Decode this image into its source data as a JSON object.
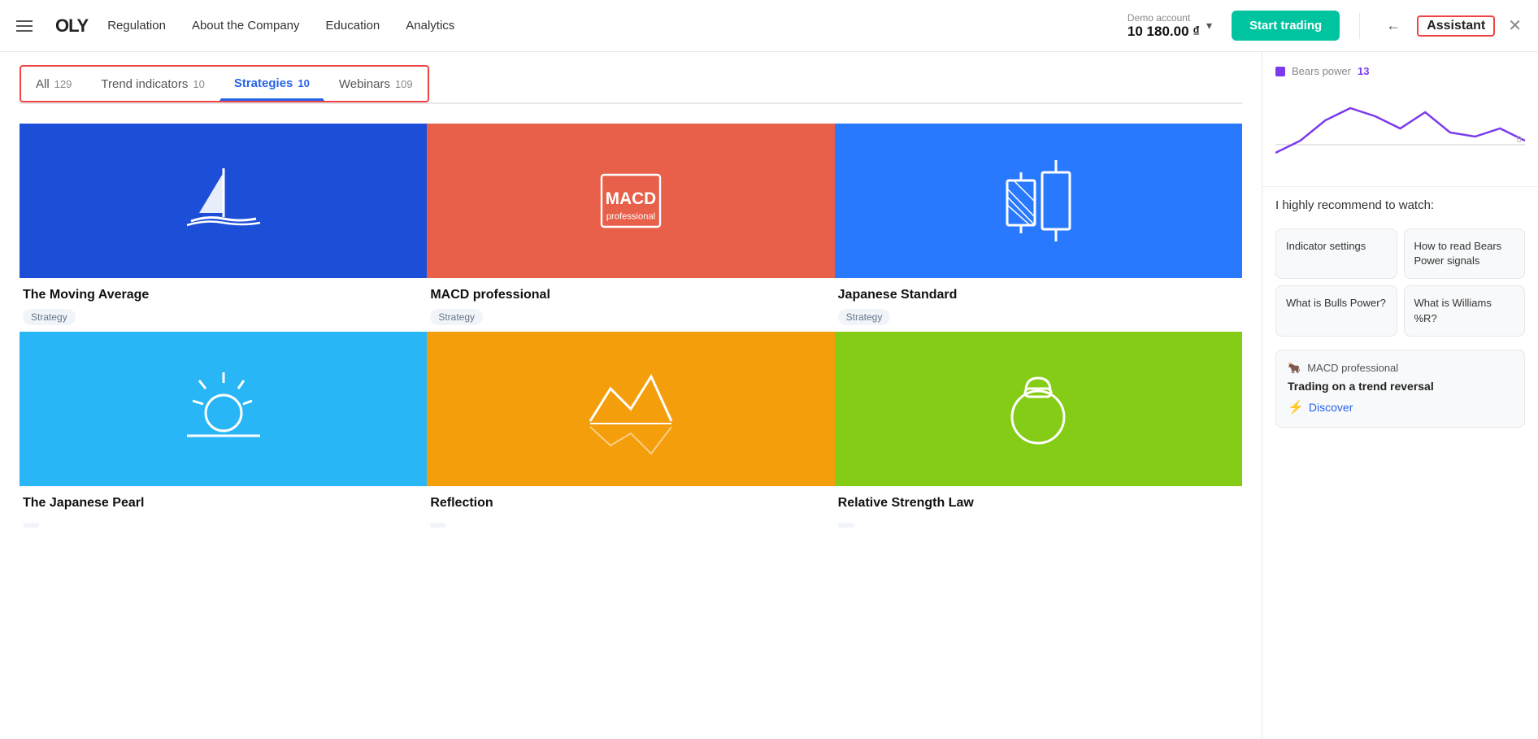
{
  "header": {
    "hamburger_label": "menu",
    "logo_text": "OLY",
    "nav": [
      {
        "label": "Regulation",
        "id": "nav-regulation"
      },
      {
        "label": "About the Company",
        "id": "nav-about"
      },
      {
        "label": "Education",
        "id": "nav-education"
      },
      {
        "label": "Analytics",
        "id": "nav-analytics"
      }
    ],
    "demo_account_label": "Demo account",
    "demo_amount": "10 180.00 ₫",
    "start_trading_label": "Start trading",
    "back_label": "←",
    "assistant_label": "Assistant",
    "close_label": "✕"
  },
  "tabs": {
    "border_note": "outlined",
    "items": [
      {
        "label": "All",
        "count": "129",
        "active": false
      },
      {
        "label": "Trend indicators",
        "count": "10",
        "active": false
      },
      {
        "label": "Strategies",
        "count": "10",
        "active": true
      },
      {
        "label": "Webinars",
        "count": "109",
        "active": false
      }
    ]
  },
  "cards": [
    {
      "id": "card-moving-average",
      "title": "The Moving Average",
      "tag": "Strategy",
      "color": "blue",
      "icon": "sailboat"
    },
    {
      "id": "card-macd",
      "title": "MACD professional",
      "tag": "Strategy",
      "color": "coral",
      "icon": "macd"
    },
    {
      "id": "card-japanese",
      "title": "Japanese Standard",
      "tag": "Strategy",
      "color": "bright-blue",
      "icon": "candlestick"
    },
    {
      "id": "card-pearl",
      "title": "The Japanese Pearl",
      "tag": "",
      "color": "light-blue",
      "icon": "sun"
    },
    {
      "id": "card-reflection",
      "title": "Reflection",
      "tag": "",
      "color": "amber",
      "icon": "mountains"
    },
    {
      "id": "card-rsl",
      "title": "Relative Strength Law",
      "tag": "",
      "color": "green",
      "icon": "kettlebell"
    }
  ],
  "panel": {
    "chart": {
      "label": "Bears power",
      "number": "13",
      "zero_label": "0"
    },
    "recommend_title": "I highly recommend to watch:",
    "suggestions": [
      {
        "label": "Indicator settings"
      },
      {
        "label": "How to read Bears Power signals"
      },
      {
        "label": "What is Bulls Power?"
      },
      {
        "label": "What is Williams %R?"
      }
    ],
    "bottom_card": {
      "header_icon": "🐂",
      "header_text": "MACD professional",
      "title": "Trading on a trend reversal",
      "discover_label": "Discover"
    }
  }
}
